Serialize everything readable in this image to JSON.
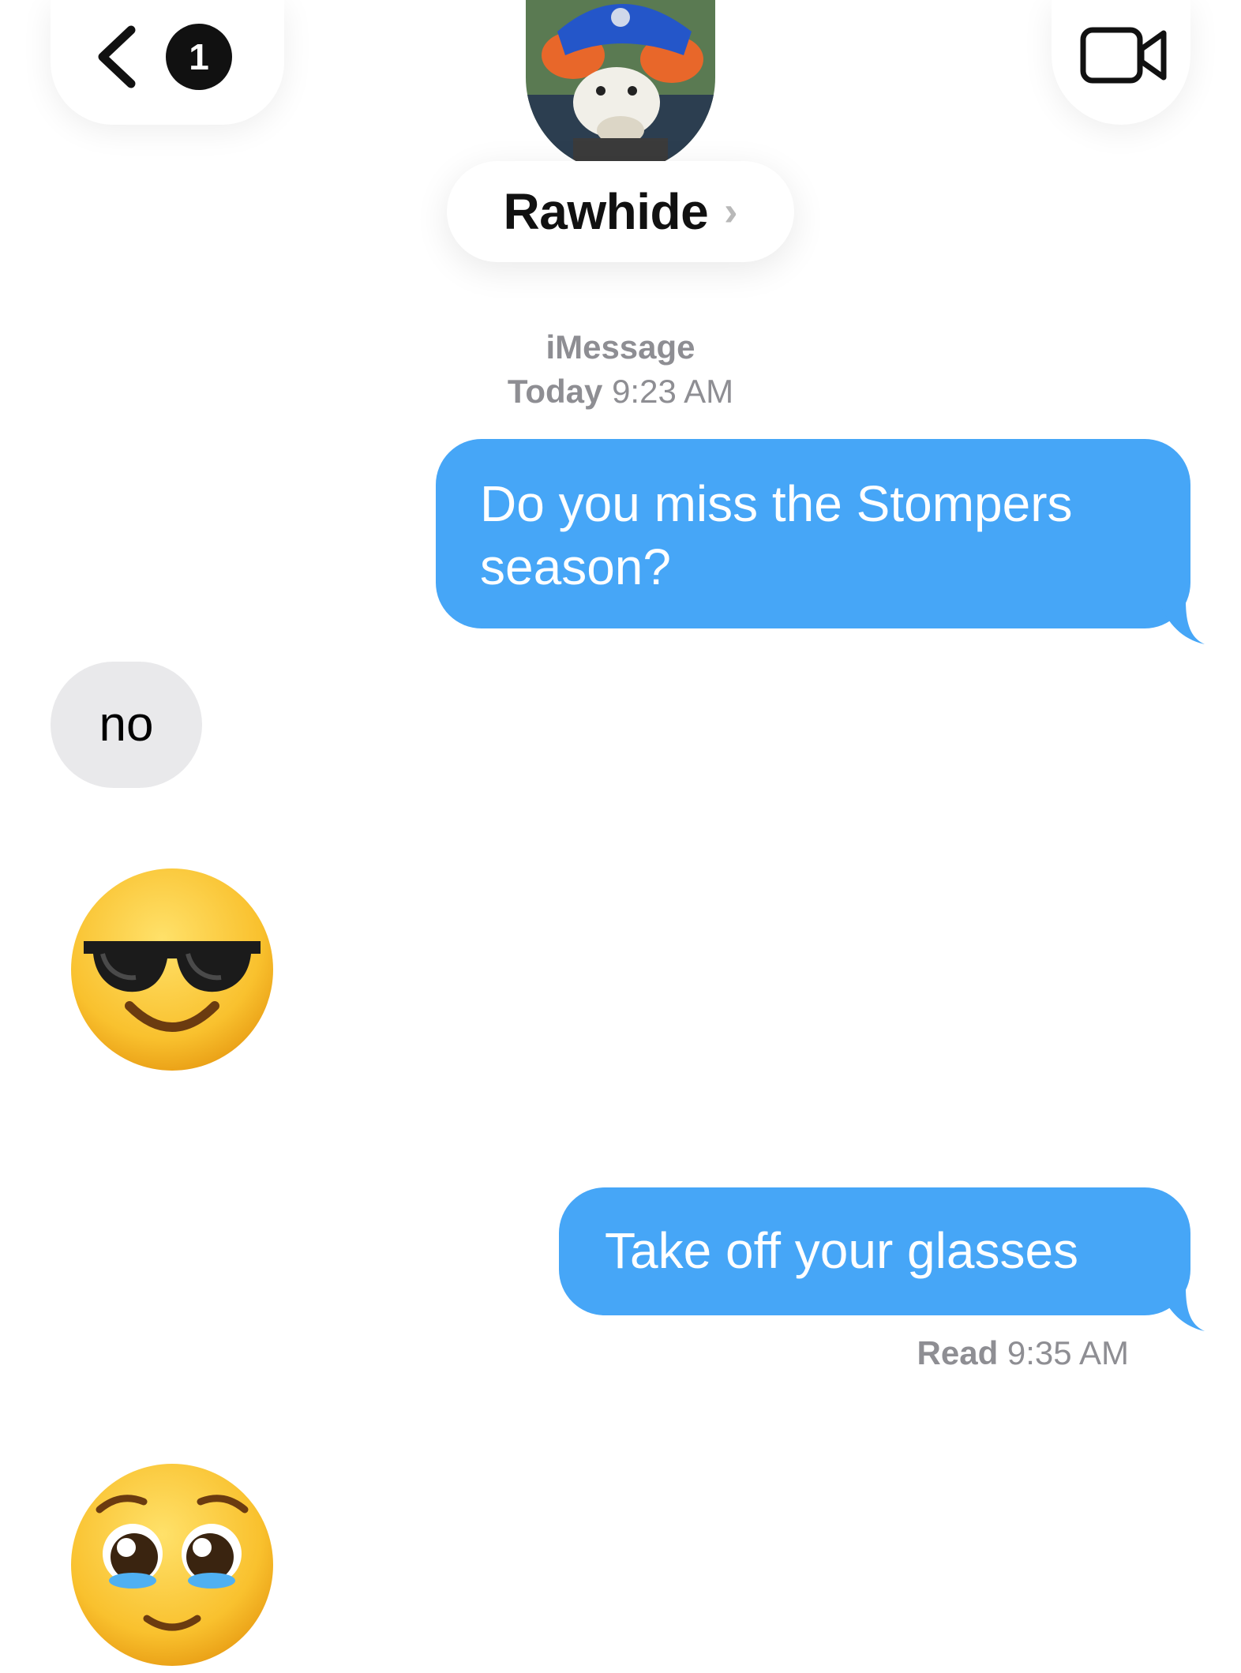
{
  "header": {
    "back_count": "1",
    "contact_name": "Rawhide",
    "contact_chevron": "›",
    "avatar_icon": "mascot-avatar",
    "video_icon": "video-camera-icon"
  },
  "thread": {
    "service": "iMessage",
    "timestamp_day": "Today",
    "timestamp_time": "9:23 AM",
    "messages": [
      {
        "direction": "outgoing",
        "text": "Do you miss the Stompers season?"
      },
      {
        "direction": "incoming",
        "text": "no"
      },
      {
        "direction": "incoming",
        "emoji": "smiling-face-with-sunglasses"
      },
      {
        "direction": "outgoing",
        "text": "Take off your glasses"
      },
      {
        "direction": "incoming",
        "emoji": "pleading-face"
      }
    ],
    "read_label": "Read",
    "read_time": "9:35 AM"
  },
  "colors": {
    "outgoing_bubble": "#46a6f7",
    "incoming_bubble": "#e9e9eb",
    "meta_text": "#8e8e93"
  }
}
